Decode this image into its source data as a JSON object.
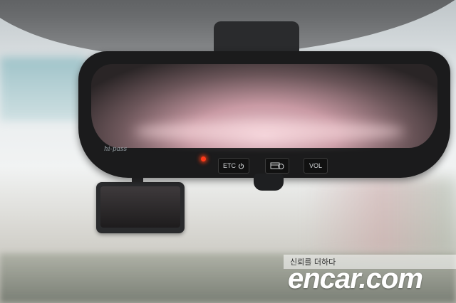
{
  "mirror": {
    "brand_label": "hi-pass",
    "etc_label": "ETC",
    "vol_label": "VOL",
    "led_color": "#ff3a1a"
  },
  "watermark": {
    "tagline": "신뢰를 더하다",
    "wordmark": "encar.com"
  }
}
